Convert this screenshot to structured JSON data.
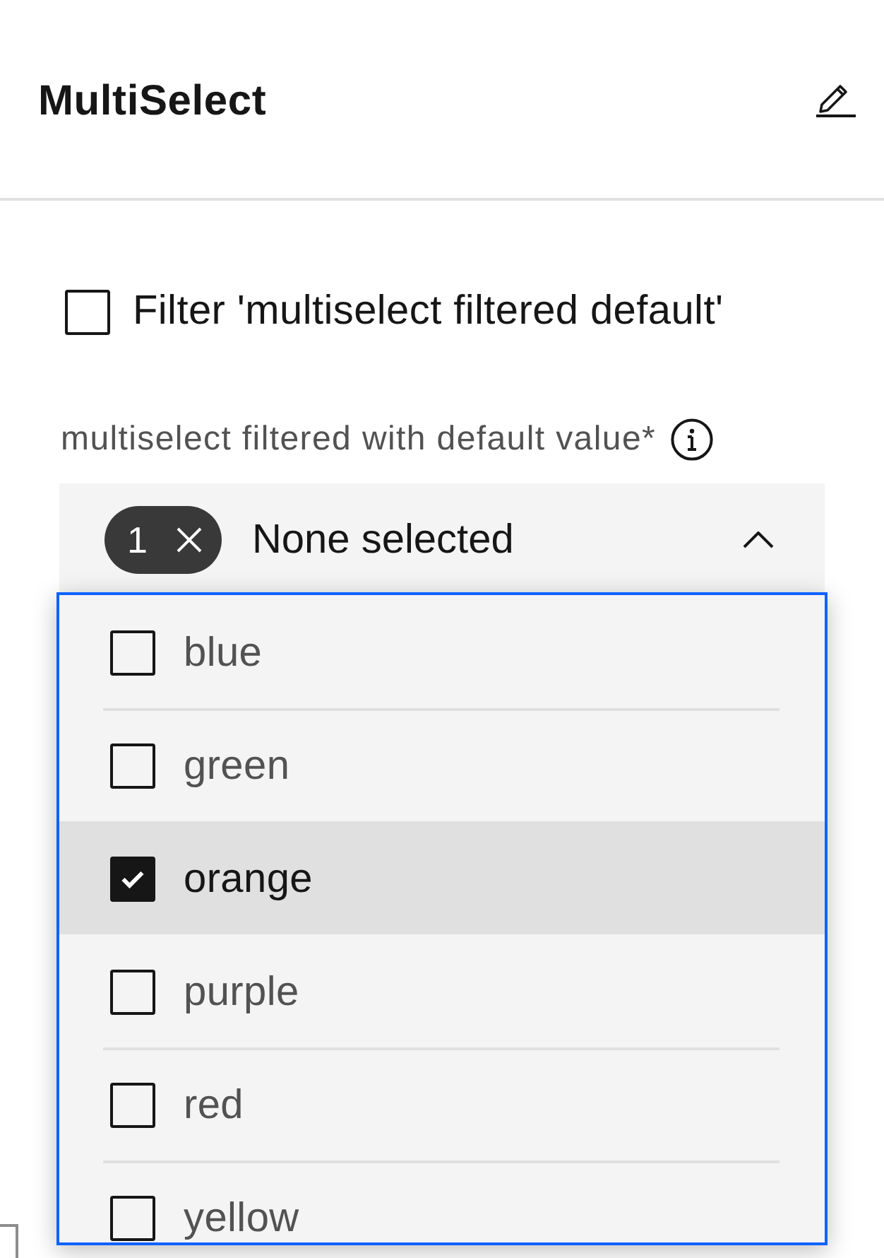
{
  "header": {
    "title": "MultiSelect"
  },
  "filter_checkbox": {
    "label": "Filter 'multiselect filtered default'",
    "checked": false
  },
  "multiselect": {
    "label": "multiselect filtered with default value*",
    "tag": {
      "count": "1"
    },
    "placeholder": "None selected",
    "expanded": true,
    "options": [
      {
        "label": "blue",
        "checked": false,
        "selected": false
      },
      {
        "label": "green",
        "checked": false,
        "selected": false
      },
      {
        "label": "orange",
        "checked": true,
        "selected": true
      },
      {
        "label": "purple",
        "checked": false,
        "selected": false
      },
      {
        "label": "red",
        "checked": false,
        "selected": false
      },
      {
        "label": "yellow",
        "checked": false,
        "selected": false
      }
    ]
  }
}
